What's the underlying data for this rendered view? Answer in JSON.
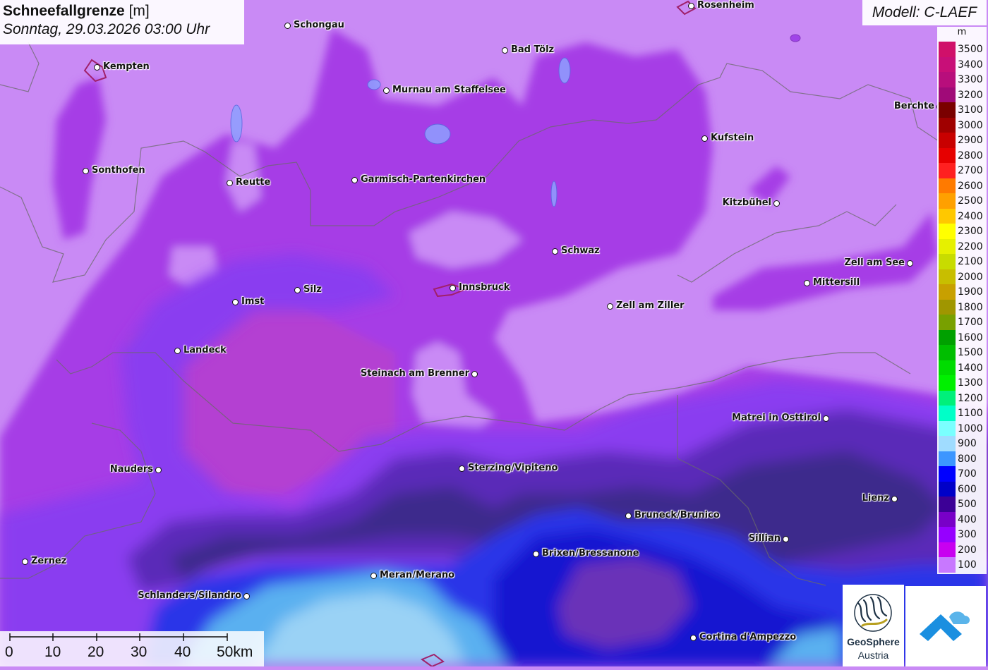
{
  "title": {
    "main": "Schneefallgrenze",
    "unit": "[m]",
    "date": "Sonntag, 29.03.2026 03:00 Uhr"
  },
  "model": "Modell: C-LAEF",
  "legend": {
    "unit": "m",
    "entries": [
      {
        "label": "3500",
        "color": "#d0106a"
      },
      {
        "label": "3400",
        "color": "#c80f78"
      },
      {
        "label": "3300",
        "color": "#b80e7c"
      },
      {
        "label": "3200",
        "color": "#a00a78"
      },
      {
        "label": "3100",
        "color": "#7a0000"
      },
      {
        "label": "3000",
        "color": "#a00000"
      },
      {
        "label": "2900",
        "color": "#c80000"
      },
      {
        "label": "2800",
        "color": "#e60000"
      },
      {
        "label": "2700",
        "color": "#ff2020"
      },
      {
        "label": "2600",
        "color": "#ff7a00"
      },
      {
        "label": "2500",
        "color": "#ffa000"
      },
      {
        "label": "2400",
        "color": "#ffc800"
      },
      {
        "label": "2300",
        "color": "#ffff00"
      },
      {
        "label": "2200",
        "color": "#e6f000"
      },
      {
        "label": "2100",
        "color": "#c8dc00"
      },
      {
        "label": "2000",
        "color": "#c8be00"
      },
      {
        "label": "1900",
        "color": "#c8a000"
      },
      {
        "label": "1800",
        "color": "#a09600"
      },
      {
        "label": "1700",
        "color": "#78a000"
      },
      {
        "label": "1600",
        "color": "#00a000"
      },
      {
        "label": "1500",
        "color": "#00be00"
      },
      {
        "label": "1400",
        "color": "#00dc00"
      },
      {
        "label": "1300",
        "color": "#00f000"
      },
      {
        "label": "1200",
        "color": "#00f07a"
      },
      {
        "label": "1100",
        "color": "#00ffc8"
      },
      {
        "label": "1000",
        "color": "#7affff"
      },
      {
        "label": "900",
        "color": "#a0dcff"
      },
      {
        "label": "800",
        "color": "#3c96ff"
      },
      {
        "label": "700",
        "color": "#0000ff"
      },
      {
        "label": "600",
        "color": "#0000c8"
      },
      {
        "label": "500",
        "color": "#3c0096"
      },
      {
        "label": "400",
        "color": "#7800c8"
      },
      {
        "label": "300",
        "color": "#9600ff"
      },
      {
        "label": "200",
        "color": "#c800f0"
      },
      {
        "label": "100",
        "color": "#c878ff"
      }
    ]
  },
  "cities": [
    {
      "name": "Rosenheim"
    },
    {
      "name": "Schongau"
    },
    {
      "name": "Bad Tölz"
    },
    {
      "name": "Kempten"
    },
    {
      "name": "Murnau am Staffelsee"
    },
    {
      "name": "Berchte"
    },
    {
      "name": "Kufstein"
    },
    {
      "name": "Sonthofen"
    },
    {
      "name": "Reutte"
    },
    {
      "name": "Garmisch-Partenkirchen"
    },
    {
      "name": "Kitzbühel"
    },
    {
      "name": "Schwaz"
    },
    {
      "name": "Zell am See"
    },
    {
      "name": "Innsbruck"
    },
    {
      "name": "Mittersill"
    },
    {
      "name": "Silz"
    },
    {
      "name": "Imst"
    },
    {
      "name": "Zell am Ziller"
    },
    {
      "name": "Landeck"
    },
    {
      "name": "Steinach am Brenner"
    },
    {
      "name": "Matrei in Osttirol"
    },
    {
      "name": "Nauders"
    },
    {
      "name": "Sterzing/Vipiteno"
    },
    {
      "name": "Lienz"
    },
    {
      "name": "Bruneck/Brunico"
    },
    {
      "name": "Sillian"
    },
    {
      "name": "Brixen/Bressanone"
    },
    {
      "name": "Zernez"
    },
    {
      "name": "Meran/Merano"
    },
    {
      "name": "Schlanders/Silandro"
    },
    {
      "name": "Cortina d'Ampezzo"
    }
  ],
  "scale": {
    "labels": [
      "0",
      "10",
      "20",
      "30",
      "40",
      "50km"
    ]
  },
  "logo": {
    "name": "GeoSphere",
    "sub": "Austria"
  }
}
